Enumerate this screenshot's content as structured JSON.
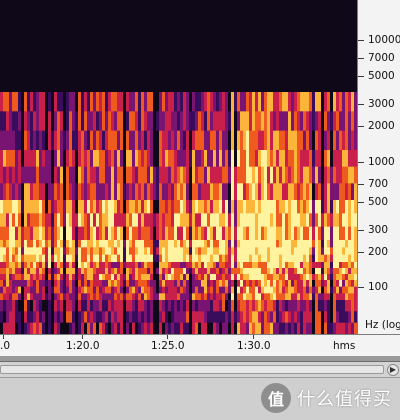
{
  "spectrogram": {
    "frequency_axis": {
      "unit_label": "Hz (log",
      "labels": [
        "10000",
        "7000",
        "5000",
        "3000",
        "2000",
        "1000",
        "700",
        "500",
        "300",
        "200",
        "100"
      ]
    },
    "time_axis": {
      "unit_label": "hms",
      "labels": [
        "1:20.0",
        "1:25.0",
        "1:30.0"
      ],
      "left_partial_label": ".0"
    },
    "colormap": [
      "#0e0818",
      "#3a0c5c",
      "#7a1472",
      "#c8204a",
      "#ef5a1e",
      "#fbb53a",
      "#fff3a0"
    ]
  },
  "scrollbar": {
    "arrow_glyph": "▶"
  },
  "watermark": {
    "logo_glyph": "值",
    "text": "什么值得买"
  }
}
